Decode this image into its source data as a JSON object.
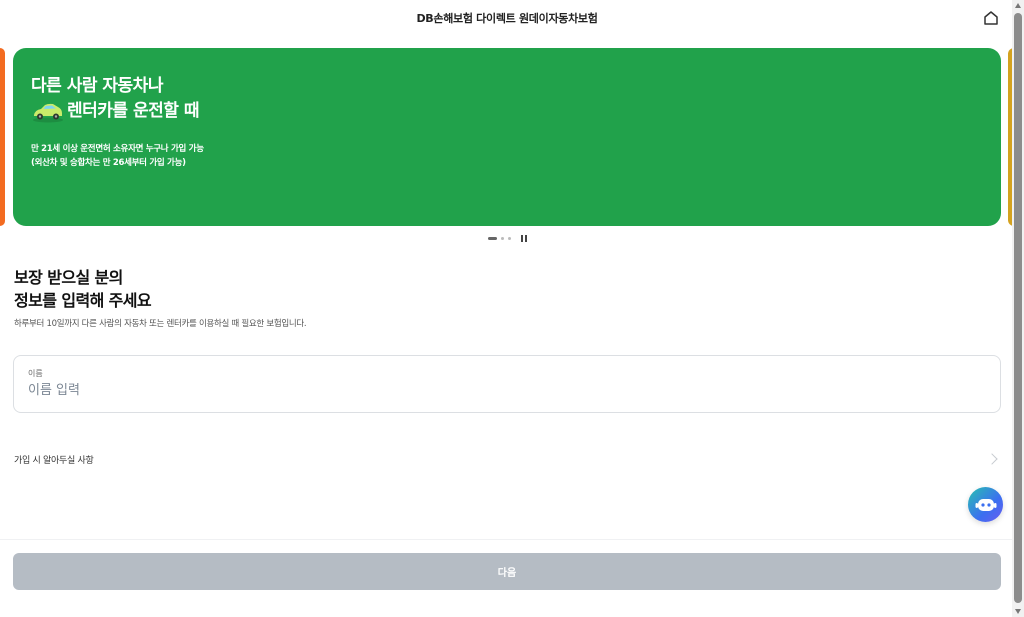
{
  "header": {
    "title": "DB손해보험 다이렉트 원데이자동차보험"
  },
  "banner": {
    "title_line1": "다른 사람 자동차나",
    "title_line2": "렌터카를 운전할 때",
    "desc_line1": "만 21세 이상 운전면허 소유자면 누구나 가입 가능",
    "desc_line2": "(외산차 및 승합차는 만 26세부터 가입 가능)",
    "color": "#21a24b",
    "prev_peek_color": "#f36b21",
    "next_peek_color": "#d4a21f"
  },
  "main": {
    "title_line1": "보장 받으실 분의",
    "title_line2": "정보를 입력해 주세요",
    "subtitle": "하루부터 10일까지 다른 사람의 자동차 또는 렌터카를 이용하실 때 필요한 보험입니다.",
    "name_field": {
      "label": "이름",
      "placeholder": "이름 입력",
      "value": ""
    },
    "notice_label": "가입 시 알아두실 사항"
  },
  "footer": {
    "next_label": "다음",
    "next_color": "#b5bcc4"
  },
  "icons": [
    "home-icon",
    "car-icon",
    "chevron-right-icon",
    "chatbot-icon",
    "pause-icon"
  ]
}
